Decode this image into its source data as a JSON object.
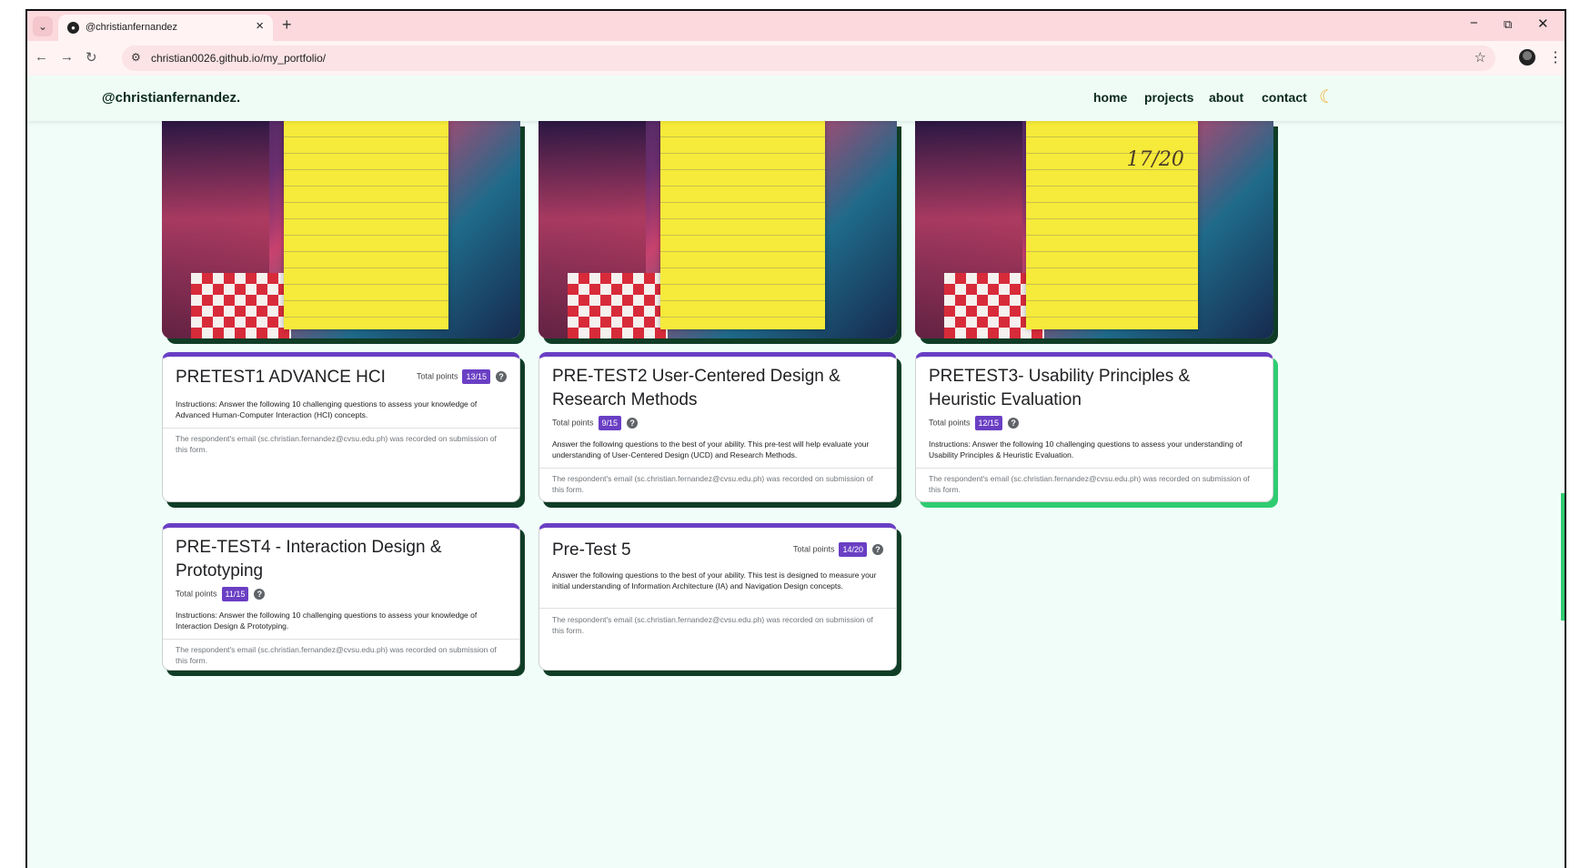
{
  "browser": {
    "tab_title": "@christianfernandez",
    "url": "christian0026.github.io/my_portfolio/",
    "new_tab": "+",
    "tab_close": "×",
    "minimize": "−",
    "restore": "⧉",
    "close": "✕"
  },
  "site": {
    "brand": "@christianfernandez.",
    "nav": {
      "home": "home",
      "projects": "projects",
      "about": "about",
      "contact": "contact"
    },
    "theme_icon": "moon-icon"
  },
  "images": [
    {
      "scrawl": ""
    },
    {
      "scrawl": ""
    },
    {
      "scrawl": "17/20"
    }
  ],
  "cards": [
    {
      "title": "PRETEST1 ADVANCE HCI",
      "points_label": "Total points",
      "score": "13/15",
      "instructions": "Instructions: Answer the following 10 challenging questions to assess your knowledge of Advanced Human-Computer Interaction (HCI) concepts.",
      "email_note": "The respondent's email (sc.christian.fernandez@cvsu.edu.ph) was recorded on submission of this form."
    },
    {
      "title": "PRE-TEST2 User-Centered Design & Research Methods",
      "points_label": "Total points",
      "score": "9/15",
      "instructions": "Answer the following questions to the best of your ability. This pre-test will help evaluate your understanding of User-Centered Design (UCD) and Research Methods.",
      "email_note": "The respondent's email (sc.christian.fernandez@cvsu.edu.ph) was recorded on submission of this form."
    },
    {
      "title": "PRETEST3- Usability Principles & Heuristic Evaluation",
      "points_label": "Total points",
      "score": "12/15",
      "instructions": "Instructions: Answer the following 10 challenging questions to assess your understanding of Usability Principles & Heuristic Evaluation.",
      "email_note": "The respondent's email (sc.christian.fernandez@cvsu.edu.ph) was recorded on submission of this form."
    },
    {
      "title": "PRE-TEST4 - Interaction Design & Prototyping",
      "points_label": "Total points",
      "score": "11/15",
      "instructions": "Instructions: Answer the following 10 challenging questions to assess your knowledge of Interaction Design & Prototyping.",
      "email_note": "The respondent's email (sc.christian.fernandez@cvsu.edu.ph) was recorded on submission of this form."
    },
    {
      "title": "Pre-Test 5",
      "points_label": "Total points",
      "score": "14/20",
      "instructions": "Answer the following questions to the best of your ability. This test is designed to measure your initial understanding of Information Architecture (IA) and Navigation Design concepts.",
      "email_note": "The respondent's email (sc.christian.fernandez@cvsu.edu.ph) was recorded on submission of this form."
    }
  ],
  "colors": {
    "page_bg": "#f0fdf8",
    "tab_bar": "#fbd9dd",
    "form_accent": "#6a3fc4",
    "card_shadow": "#0f3d26",
    "highlight_shadow": "#2ecc71"
  }
}
